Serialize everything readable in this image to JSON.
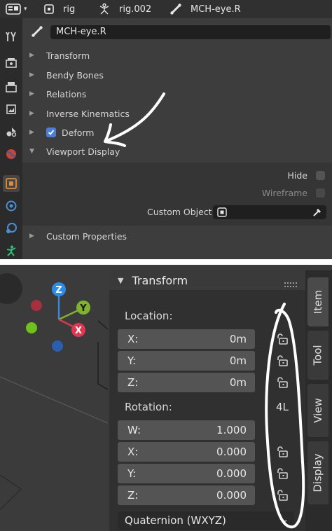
{
  "header": {
    "editor_icon": "properties-editor-icon",
    "object_name": "rig",
    "armature_name": "rig.002",
    "bone_name": "MCH-eye.R"
  },
  "properties_tabs": [
    {
      "icon": "tool-icon"
    },
    {
      "icon": "render-icon"
    },
    {
      "icon": "output-icon"
    },
    {
      "icon": "view-layer-icon"
    },
    {
      "icon": "scene-icon"
    },
    {
      "icon": "world-icon"
    },
    {
      "icon": "object-icon"
    },
    {
      "icon": "modifiers-icon"
    },
    {
      "icon": "physics-icon"
    },
    {
      "icon": "armature-icon"
    }
  ],
  "bone_panel": {
    "name_field": "MCH-eye.R",
    "sections": [
      "Transform",
      "Bendy Bones",
      "Relations",
      "Inverse Kinematics",
      "Deform",
      "Viewport Display",
      "Custom Properties"
    ],
    "deform_checked": true,
    "viewport_display": {
      "hide_label": "Hide",
      "wireframe_label": "Wireframe",
      "custom_object_label": "Custom Object"
    }
  },
  "n_panel": {
    "title": "Transform",
    "location_label": "Location:",
    "location": [
      {
        "axis": "X:",
        "value": "0m"
      },
      {
        "axis": "Y:",
        "value": "0m"
      },
      {
        "axis": "Z:",
        "value": "0m"
      }
    ],
    "rotation_label": "Rotation:",
    "rotation_lock_mode": "4L",
    "rotation": [
      {
        "axis": "W:",
        "value": "1.000"
      },
      {
        "axis": "X:",
        "value": "0.000"
      },
      {
        "axis": "Y:",
        "value": "0.000"
      },
      {
        "axis": "Z:",
        "value": "0.000"
      }
    ],
    "rotation_mode": "Quaternion (WXYZ)"
  },
  "n_panel_tabs": [
    "Item",
    "Tool",
    "View",
    "Display"
  ],
  "gizmo_axes": [
    "Z",
    "Y",
    "X"
  ],
  "colors": {
    "accent_blue": "#4b7fd6",
    "axis_x": "#e0364f",
    "axis_y": "#7fb22d",
    "axis_z": "#2c8ce6"
  }
}
